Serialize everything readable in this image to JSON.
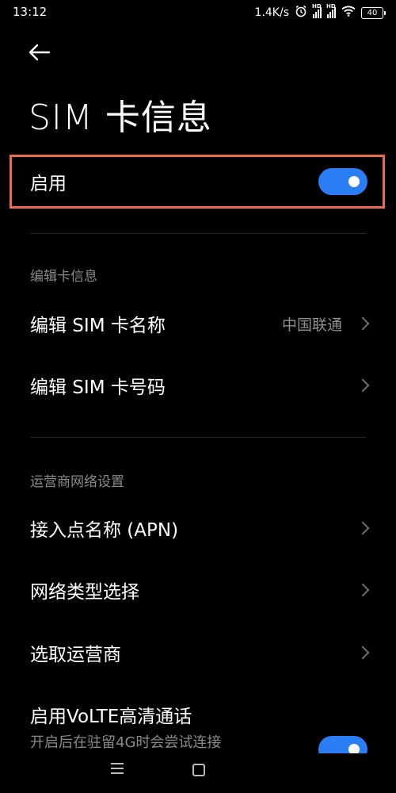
{
  "status_bar": {
    "time": "13:12",
    "speed": "1.4K/s",
    "sim1_hd": "HD",
    "sim2_hd": "HD",
    "battery": "40"
  },
  "header": {
    "title": "SIM 卡信息"
  },
  "enable_row": {
    "label": "启用",
    "enabled": true
  },
  "section_edit": {
    "header": "编辑卡信息",
    "items": [
      {
        "label": "编辑 SIM 卡名称",
        "value": "中国联通"
      },
      {
        "label": "编辑 SIM 卡号码"
      }
    ]
  },
  "section_carrier": {
    "header": "运营商网络设置",
    "items": [
      {
        "label": "接入点名称 (APN)"
      },
      {
        "label": "网络类型选择"
      },
      {
        "label": "选取运营商"
      }
    ]
  },
  "volte": {
    "label": "启用VoLTE高清通话",
    "sub": "开启后在驻留4G时会尝试连接",
    "enabled": true
  },
  "colors": {
    "accent": "#2a7df4",
    "highlight": "#ee6a4a",
    "background": "#000000"
  }
}
